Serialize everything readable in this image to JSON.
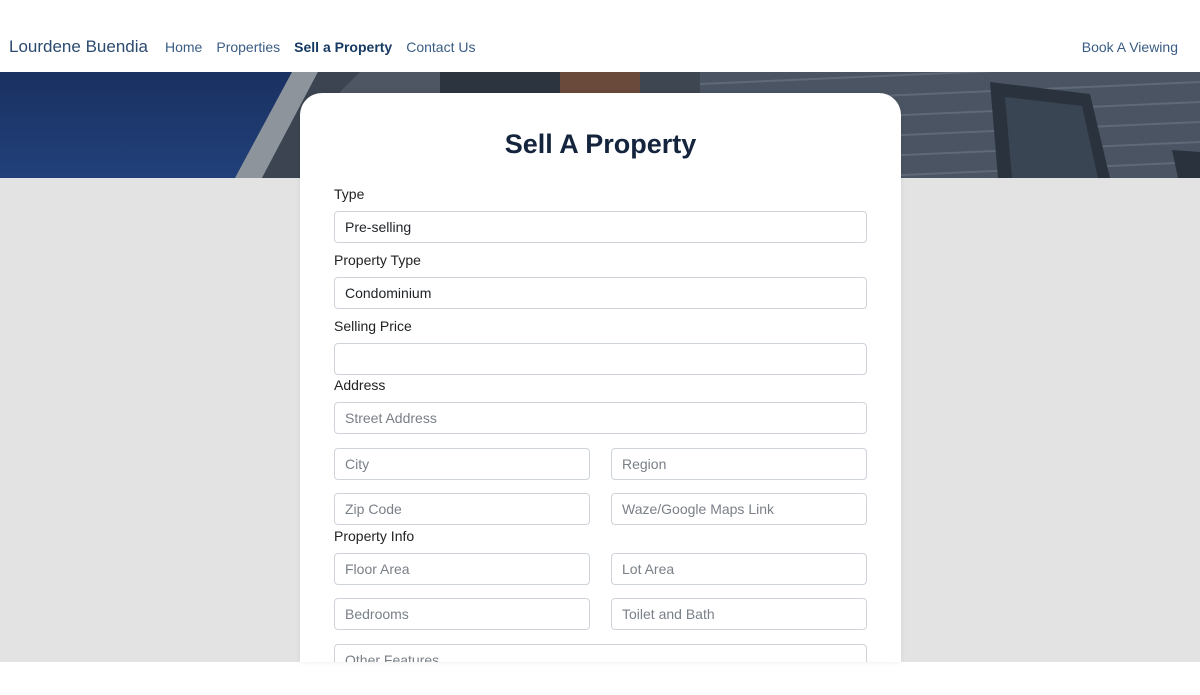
{
  "navbar": {
    "brand": "Lourdene Buendia",
    "links": [
      {
        "label": "Home"
      },
      {
        "label": "Properties"
      },
      {
        "label": "Sell a Property"
      },
      {
        "label": "Contact Us"
      }
    ],
    "cta": "Book A Viewing"
  },
  "form": {
    "title": "Sell A Property",
    "type": {
      "label": "Type",
      "value": "Pre-selling"
    },
    "property_type": {
      "label": "Property Type",
      "value": "Condominium"
    },
    "selling_price": {
      "label": "Selling Price",
      "value": ""
    },
    "address": {
      "label": "Address",
      "street_placeholder": "Street Address",
      "city_placeholder": "City",
      "region_placeholder": "Region",
      "zip_placeholder": "Zip Code",
      "map_link_placeholder": "Waze/Google Maps Link"
    },
    "property_info": {
      "label": "Property Info",
      "floor_area_placeholder": "Floor Area",
      "lot_area_placeholder": "Lot Area",
      "bedrooms_placeholder": "Bedrooms",
      "toilet_bath_placeholder": "Toilet and Bath",
      "other_features_placeholder": "Other Features"
    }
  },
  "colors": {
    "brand_text": "#2b4a6e",
    "nav_link": "#3a5d85",
    "nav_active": "#173a63",
    "hero_blue": "#1d3766",
    "page_bg": "#e3e3e3",
    "title_text": "#14243d"
  }
}
